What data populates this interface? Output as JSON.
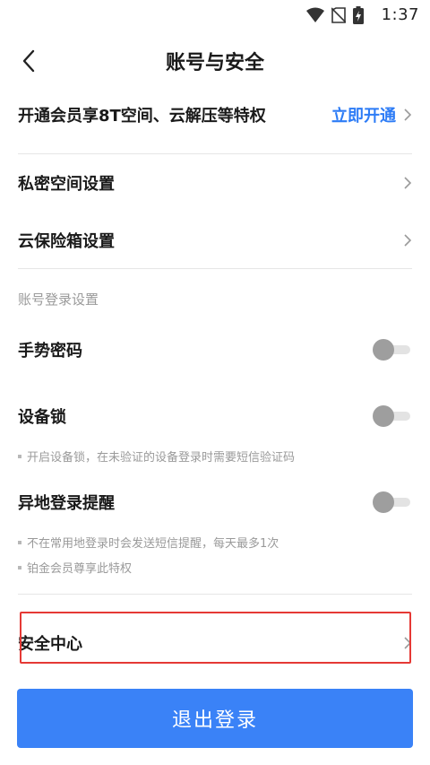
{
  "status_bar": {
    "time": "1:37",
    "icons": [
      "wifi-icon",
      "no-sim-icon",
      "battery-charging-icon"
    ]
  },
  "header": {
    "title": "账号与安全",
    "back_icon": "chevron-left-icon"
  },
  "vip": {
    "label": "开通会员享8T空间、云解压等特权",
    "action": "立即开通"
  },
  "settings": {
    "private_space": "私密空间设置",
    "vault": "云保险箱设置"
  },
  "login_settings": {
    "section_label": "账号登录设置",
    "gesture_password": {
      "label": "手势密码",
      "enabled": false
    },
    "device_lock": {
      "label": "设备锁",
      "enabled": false,
      "hint": "开启设备锁，在未验证的设备登录时需要短信验证码"
    },
    "remote_login_alert": {
      "label": "异地登录提醒",
      "enabled": false,
      "hints": [
        "不在常用地登录时会发送短信提醒，每天最多1次",
        "铂金会员尊享此特权"
      ]
    }
  },
  "security_center": {
    "label": "安全中心"
  },
  "logout": {
    "label": "退出登录"
  },
  "colors": {
    "accent": "#2d7cf6",
    "button": "#3a82f7",
    "highlight": "#e53935",
    "muted": "#9a9a9a"
  }
}
